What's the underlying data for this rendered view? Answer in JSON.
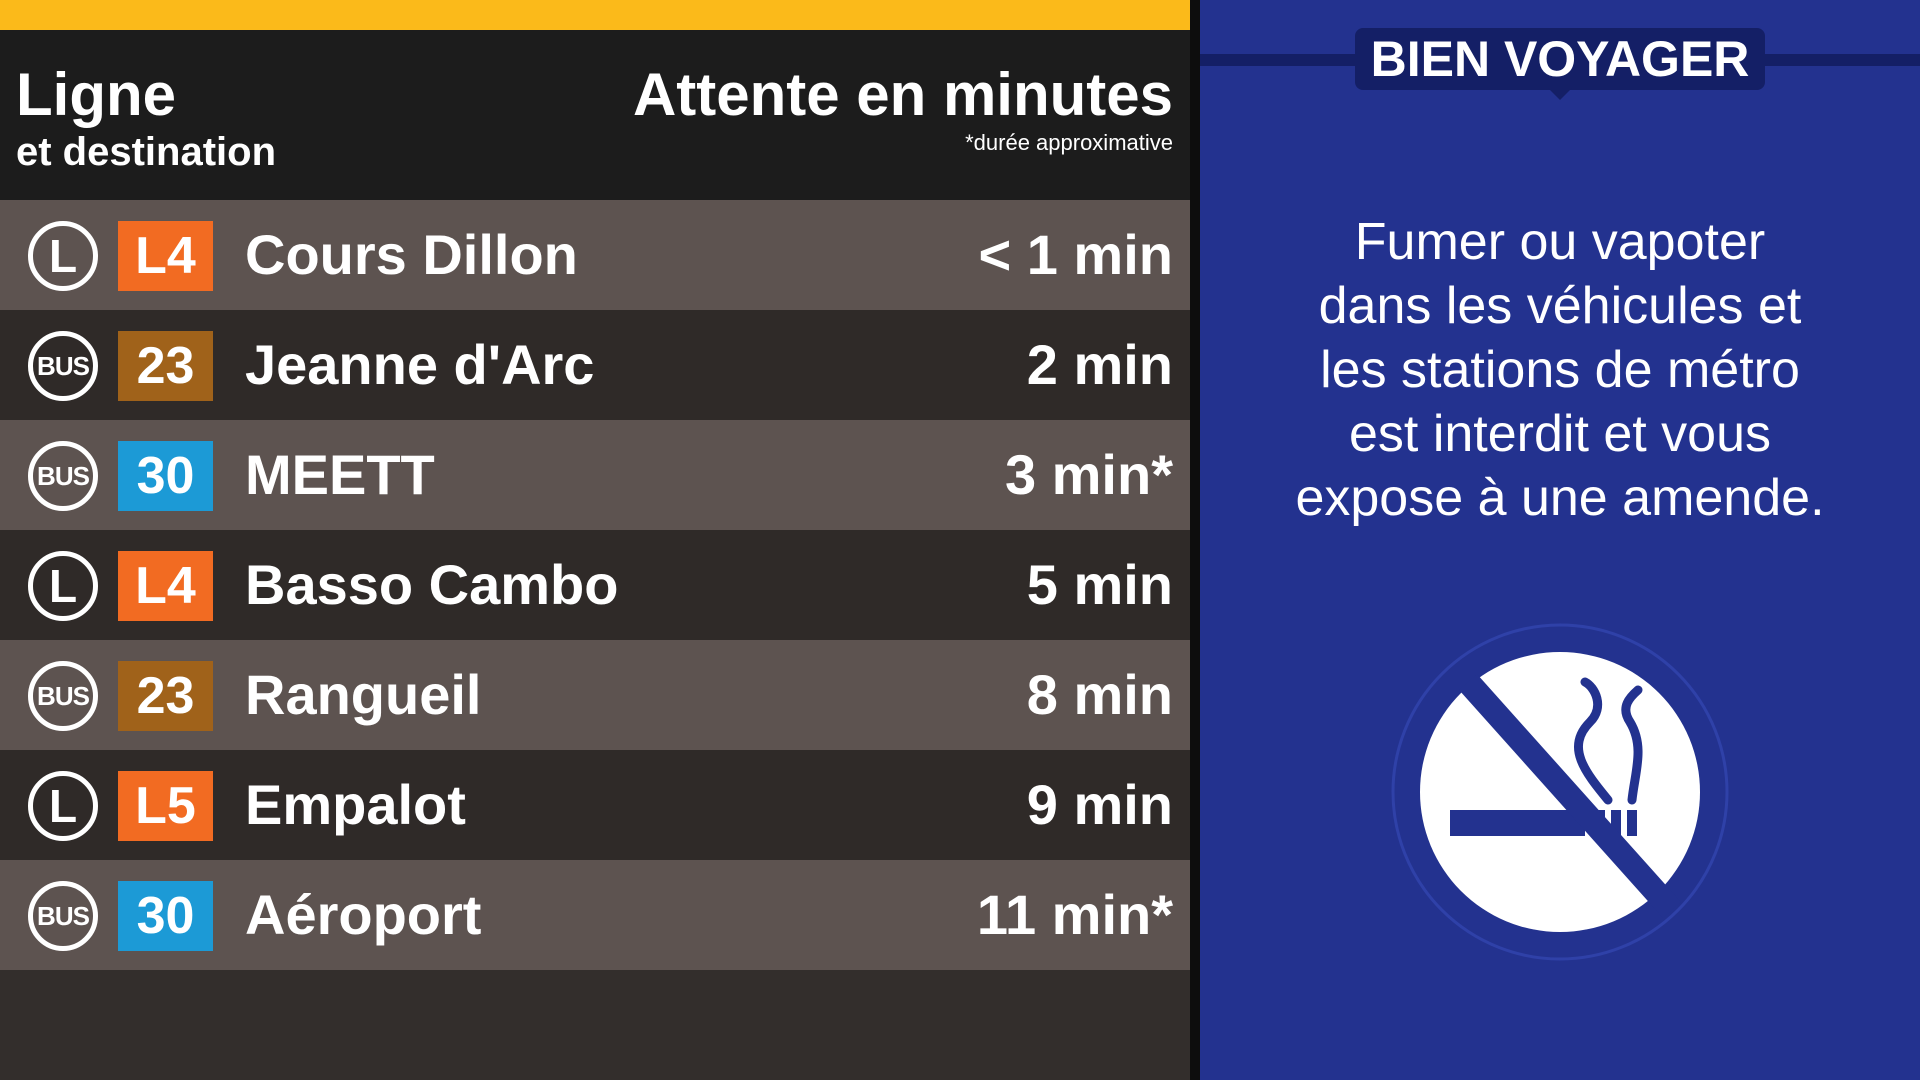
{
  "header": {
    "line_label": "Ligne",
    "destination_label": "et destination",
    "wait_label": "Attente en minutes",
    "approx_note": "*durée approximative"
  },
  "departures": [
    {
      "mode": "L",
      "mode_icon": "metro-icon",
      "line": "L4",
      "line_color": "#f26b22",
      "destination": "Cours Dillon",
      "wait": "< 1 min"
    },
    {
      "mode": "BUS",
      "mode_icon": "bus-icon",
      "line": "23",
      "line_color": "#a0621a",
      "destination": "Jeanne d'Arc",
      "wait": "2 min"
    },
    {
      "mode": "BUS",
      "mode_icon": "bus-icon",
      "line": "30",
      "line_color": "#1c9ad6",
      "destination": "MEETT",
      "wait": "3 min*"
    },
    {
      "mode": "L",
      "mode_icon": "metro-icon",
      "line": "L4",
      "line_color": "#f26b22",
      "destination": "Basso Cambo",
      "wait": "5 min"
    },
    {
      "mode": "BUS",
      "mode_icon": "bus-icon",
      "line": "23",
      "line_color": "#a0621a",
      "destination": "Rangueil",
      "wait": "8 min"
    },
    {
      "mode": "L",
      "mode_icon": "metro-icon",
      "line": "L5",
      "line_color": "#f26b22",
      "destination": "Empalot",
      "wait": "9 min"
    },
    {
      "mode": "BUS",
      "mode_icon": "bus-icon",
      "line": "30",
      "line_color": "#1c9ad6",
      "destination": "Aéroport",
      "wait": "11 min*"
    }
  ],
  "info_panel": {
    "title": "BIEN VOYAGER",
    "message_lines": [
      "Fumer ou vapoter",
      "dans les véhicules et",
      "les stations de métro",
      "est interdit et vous",
      "expose à une amende."
    ],
    "icon": "no-smoking-icon"
  },
  "colors": {
    "accent_bar": "#fbba1a",
    "panel_blue": "#23328f",
    "panel_dark_blue": "#141f66",
    "row_light": "#5d5350",
    "row_dark": "#2f2a28"
  }
}
